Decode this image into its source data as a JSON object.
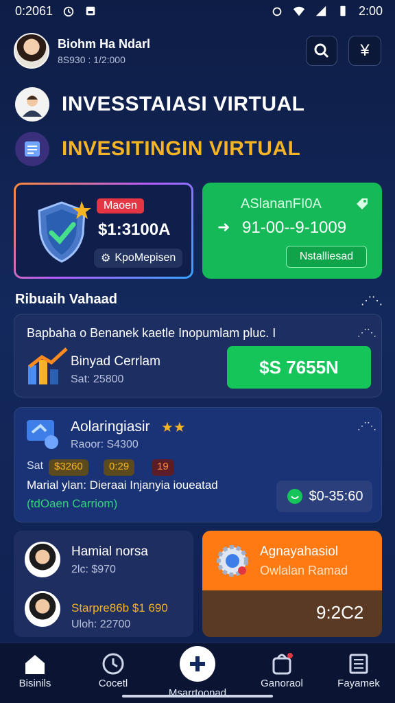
{
  "status_bar": {
    "time_left": "0:2061",
    "time_right": "2:00"
  },
  "header": {
    "user_name": "Biohm Ha Ndarl",
    "user_sub": "8S930 : 1/2:000"
  },
  "titles": {
    "main": "INVESSTAIASI VIRTUAL",
    "secondary": "INVESITINGIN VIRTUAL"
  },
  "shield_card": {
    "badge": "Maoen",
    "amount": "$1:3100A",
    "pill_label": "KpoMepisen"
  },
  "green_card": {
    "title": "ASlananFI0A",
    "value": "91-00--9-1009",
    "button": "Nstalliesad"
  },
  "section": {
    "title": "Ribuaih Vahaad"
  },
  "panel1": {
    "headline": "Bapbaha o Benanek kaetle Inopumlam pluc. I",
    "item_title": "Binyad Cerrlam",
    "item_sub": "Sat: 25800",
    "button": "$S 7655N"
  },
  "panel2": {
    "title": "Aolaringiasir",
    "stars": "★★",
    "sub": "Raoor: S4300",
    "chip1_prefix": "Sat",
    "chip1": "$3260",
    "chip2": "0:29",
    "chip3": "19",
    "desc": "Marial ylan: Dieraai Injanyia ioueatad",
    "link": "(tdOaen Carriom)",
    "button": "$0-35:60"
  },
  "people_card": {
    "p1_name": "Hamial norsa",
    "p1_sub": "2lc: $970",
    "p2_name": "Starpre86b $1 690",
    "p2_sub": "Uloh: 22700"
  },
  "orange_card": {
    "title": "Agnayahasiol",
    "sub": "Owlalan Ramad",
    "value": "9:2C2"
  },
  "bottom_nav": {
    "home": "Bisinils",
    "clock": "Cocetl",
    "center": "Msarrtoonad",
    "bag": "Ganoraol",
    "list": "Fayamek"
  },
  "colors": {
    "accent_green": "#16c55a",
    "accent_orange": "#ff7a13",
    "title_gold": "#f5b423",
    "bg_navy": "#13285c"
  }
}
